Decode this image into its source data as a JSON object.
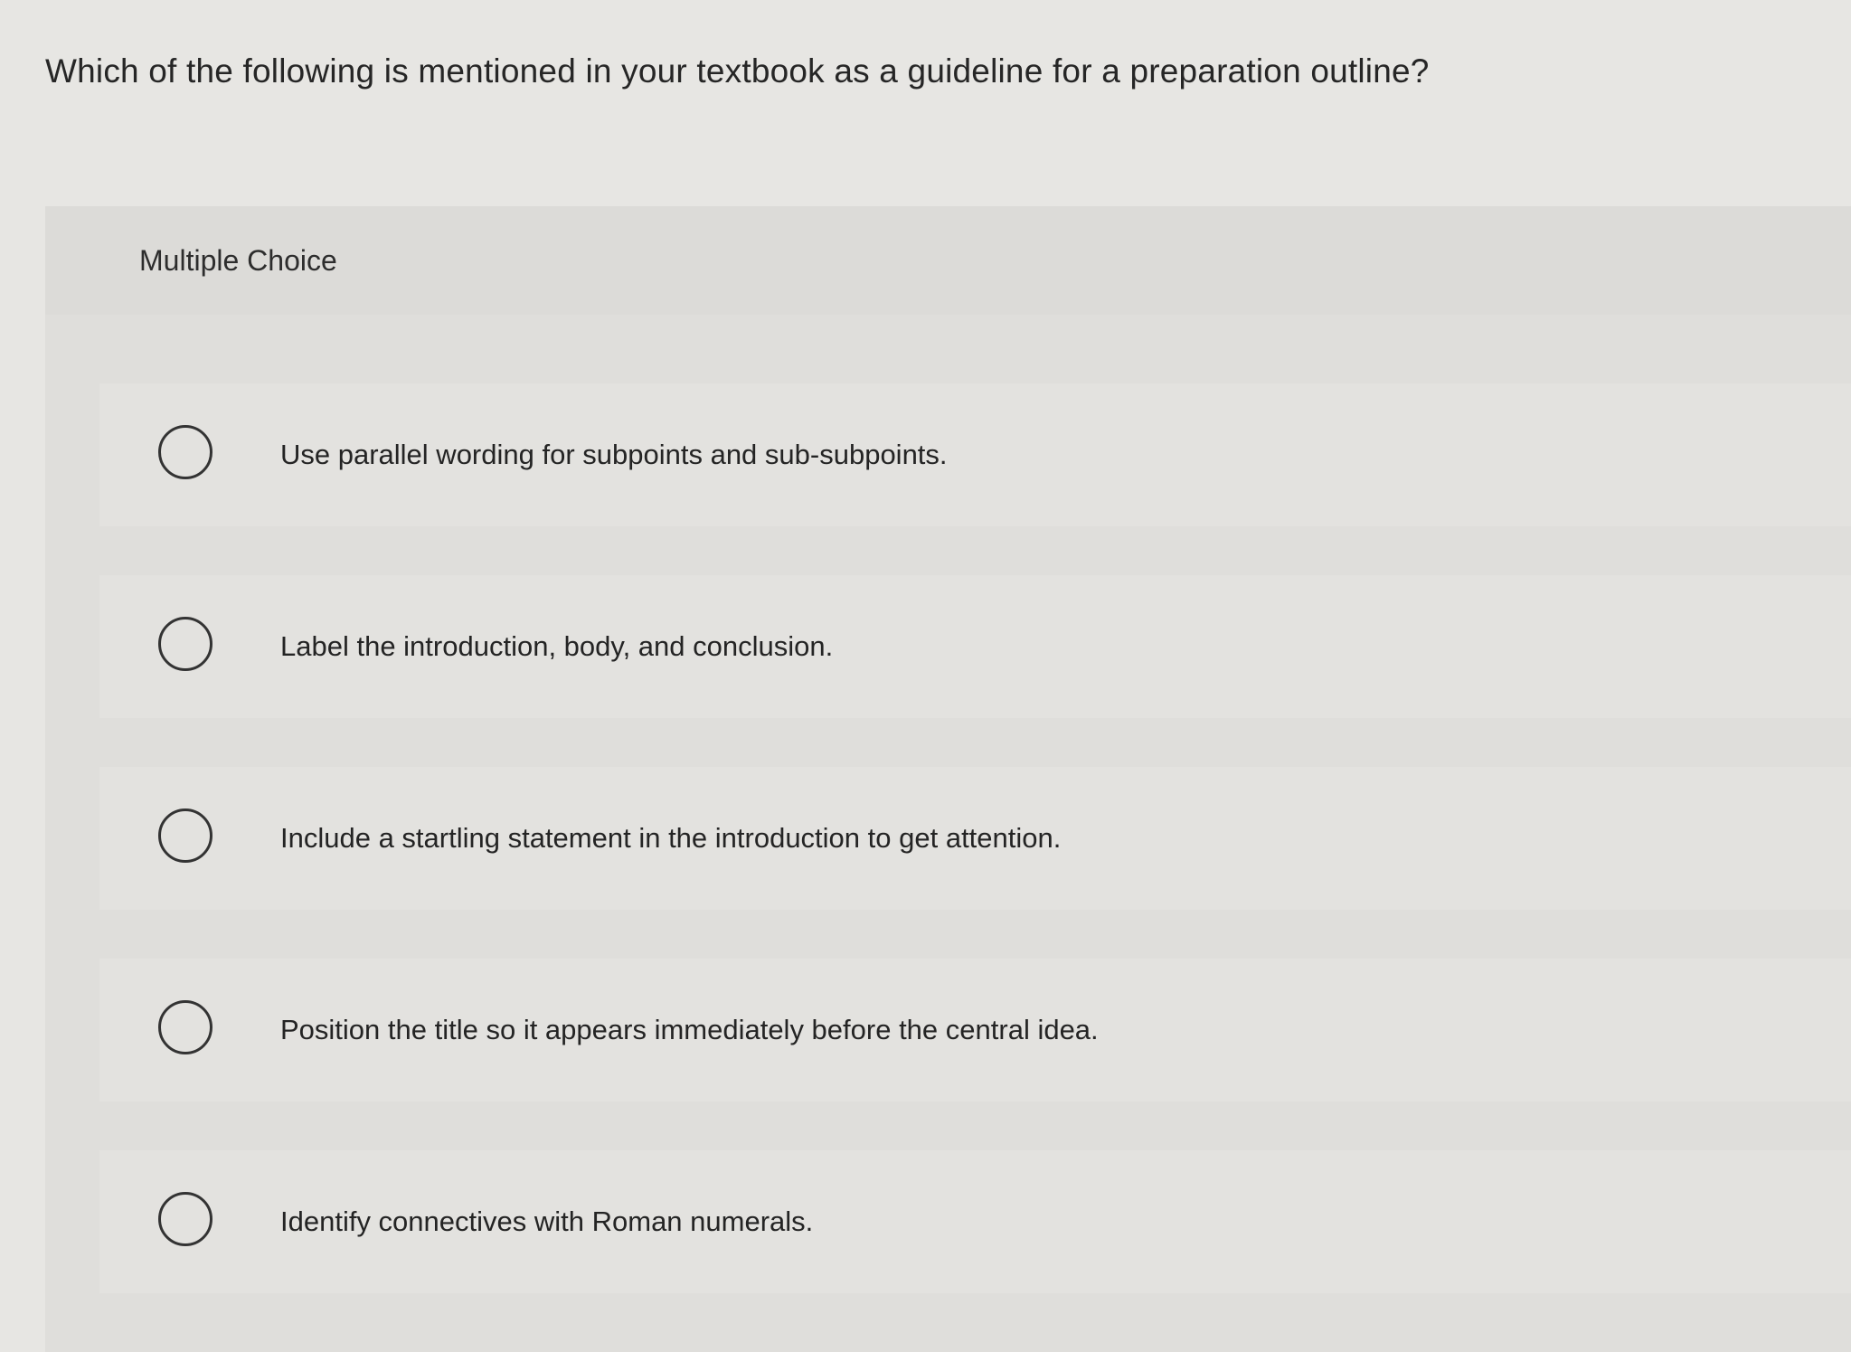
{
  "question": {
    "text": "Which of the following is mentioned in your textbook as a guideline for a preparation outline?"
  },
  "panel": {
    "title": "Multiple Choice"
  },
  "options": [
    {
      "label": "Use parallel wording for subpoints and sub-subpoints."
    },
    {
      "label": "Label the introduction, body, and conclusion."
    },
    {
      "label": "Include a startling statement in the introduction to get attention."
    },
    {
      "label": "Position the title so it appears immediately before the central idea."
    },
    {
      "label": "Identify connectives with Roman numerals."
    }
  ]
}
